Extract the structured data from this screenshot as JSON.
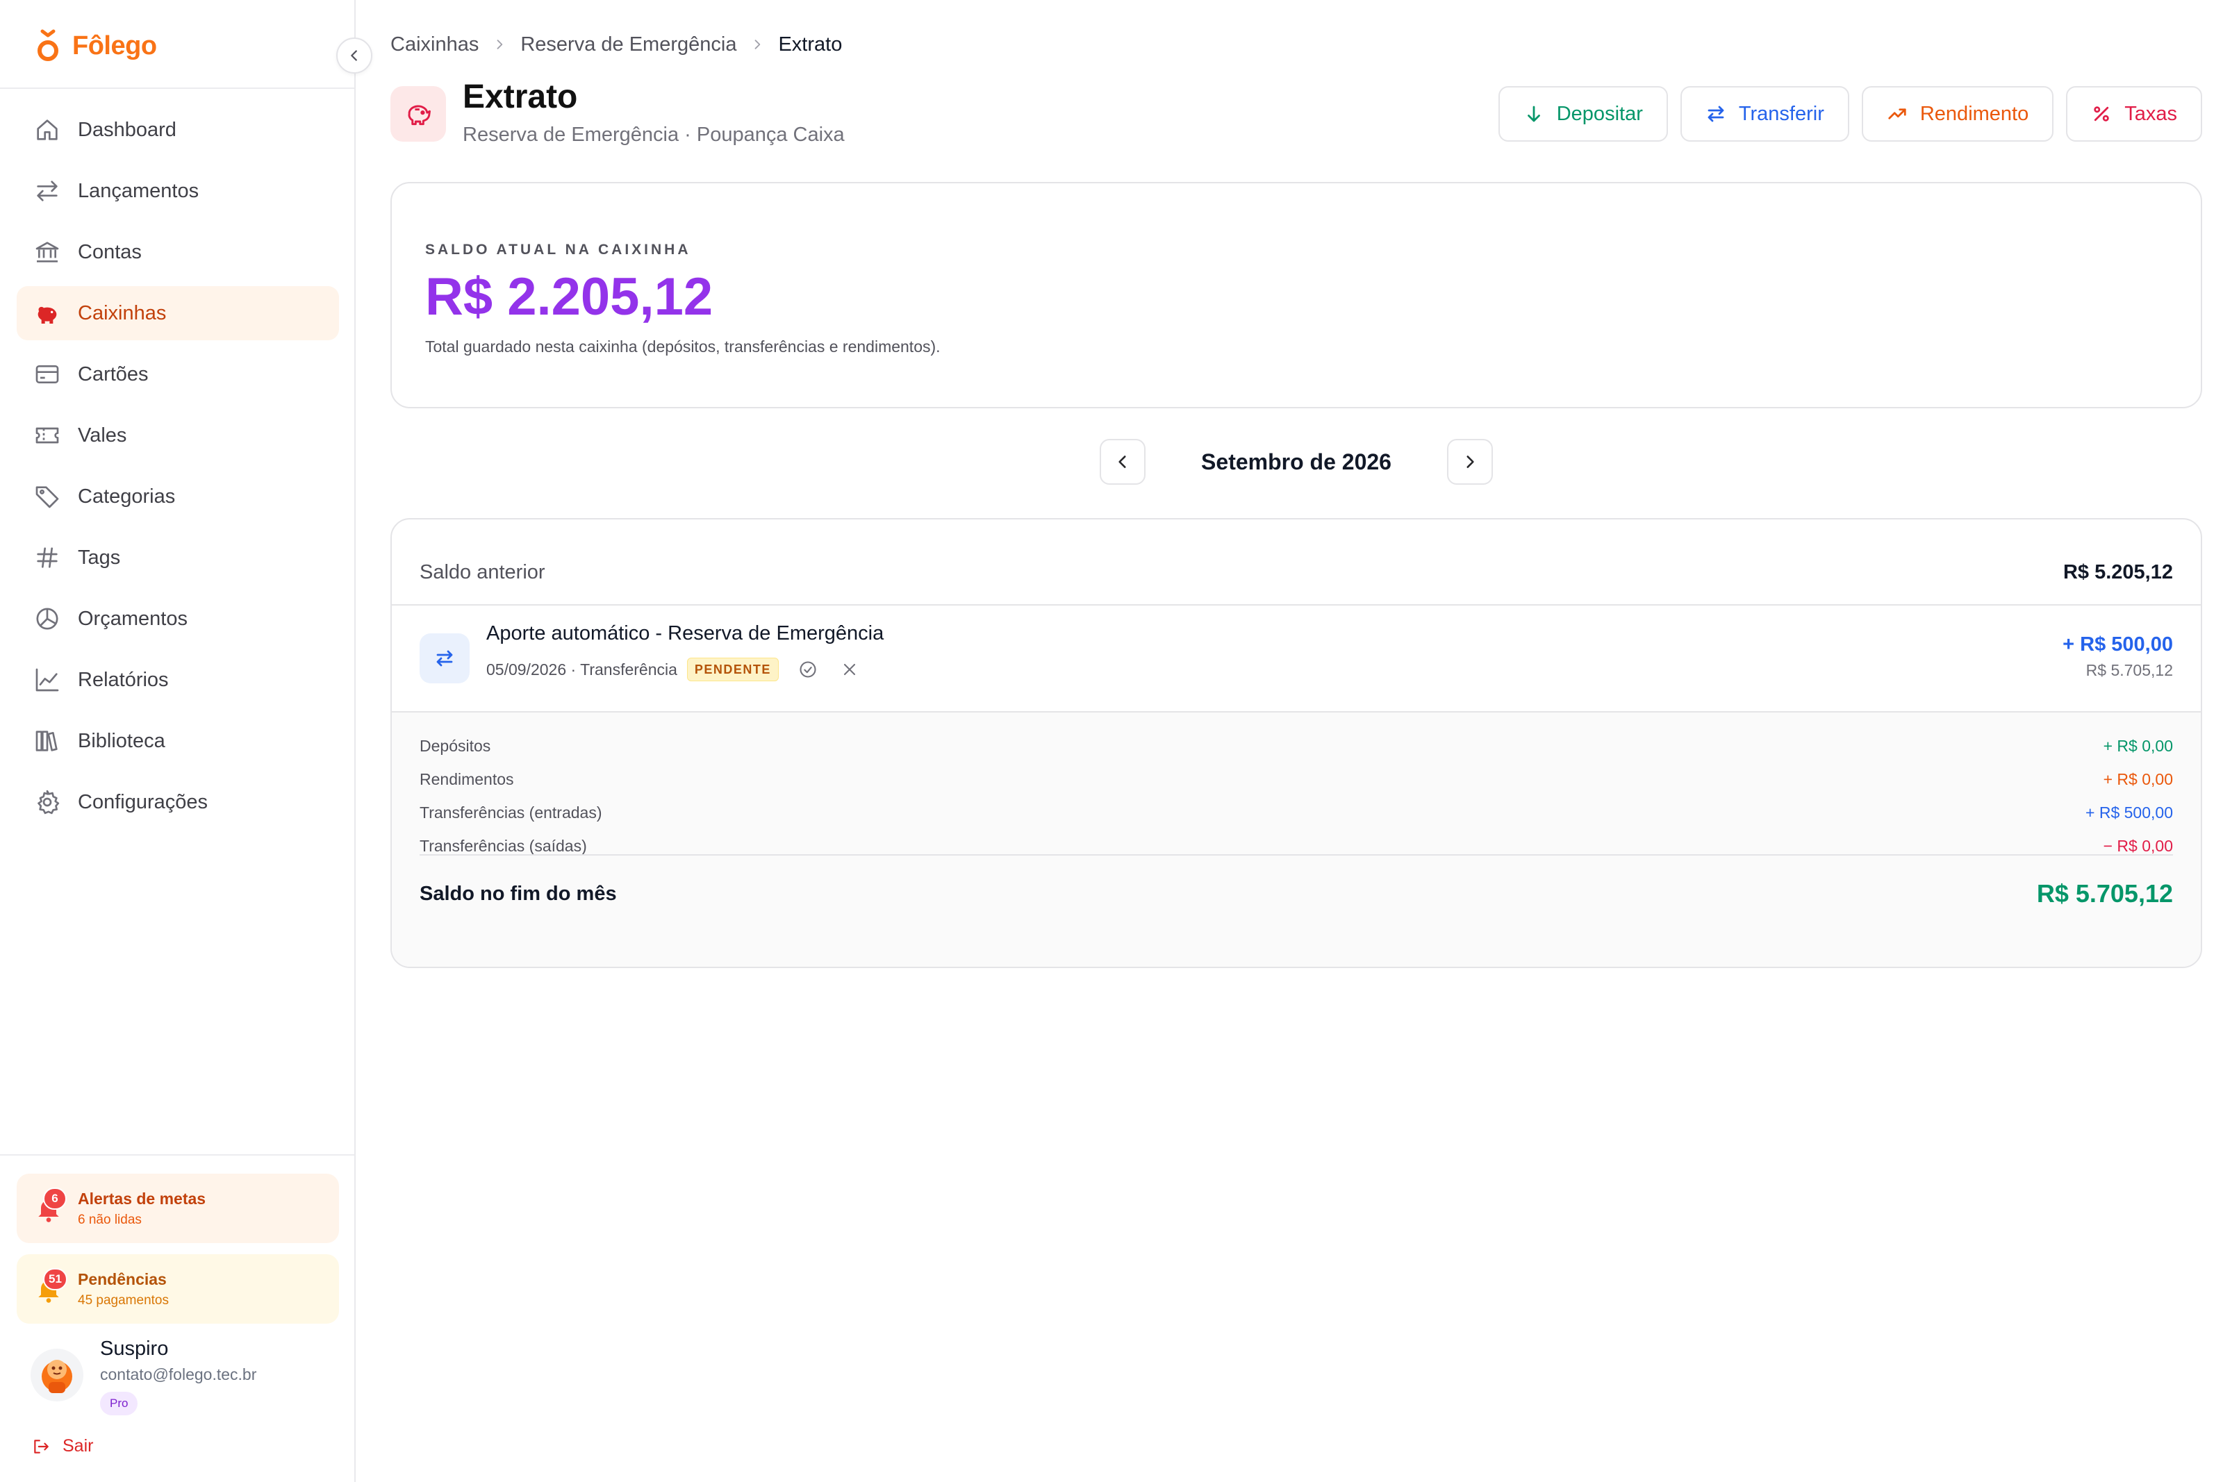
{
  "brand": {
    "name": "Fôlego",
    "color": "#f97316"
  },
  "sidebar": {
    "items": [
      {
        "label": "Dashboard",
        "icon": "home-icon"
      },
      {
        "label": "Lançamentos",
        "icon": "swap-icon"
      },
      {
        "label": "Contas",
        "icon": "bank-icon"
      },
      {
        "label": "Caixinhas",
        "icon": "piggy-bank-icon",
        "active": true
      },
      {
        "label": "Cartões",
        "icon": "credit-card-icon"
      },
      {
        "label": "Vales",
        "icon": "ticket-icon"
      },
      {
        "label": "Categorias",
        "icon": "tag-icon"
      },
      {
        "label": "Tags",
        "icon": "hash-icon"
      },
      {
        "label": "Orçamentos",
        "icon": "pie-chart-icon"
      },
      {
        "label": "Relatórios",
        "icon": "line-chart-icon"
      },
      {
        "label": "Biblioteca",
        "icon": "library-icon"
      },
      {
        "label": "Configurações",
        "icon": "gear-icon"
      }
    ],
    "alerts": {
      "metas": {
        "count": "6",
        "title": "Alertas de metas",
        "subtitle": "6 não lidas"
      },
      "pendencias": {
        "count": "51",
        "title": "Pendências",
        "subtitle": "45 pagamentos"
      }
    },
    "user": {
      "name": "Suspiro",
      "email": "contato@folego.tec.br",
      "plan": "Pro"
    },
    "logout_label": "Sair"
  },
  "breadcrumb": [
    "Caixinhas",
    "Reserva de Emergência",
    "Extrato"
  ],
  "header": {
    "title": "Extrato",
    "subtitle": "Reserva de Emergência · Poupança Caixa"
  },
  "actions": {
    "deposit": "Depositar",
    "transfer": "Transferir",
    "yield": "Rendimento",
    "fees": "Taxas"
  },
  "balance": {
    "label": "SALDO ATUAL NA CAIXINHA",
    "value": "R$ 2.205,12",
    "note": "Total guardado nesta caixinha (depósitos, transferências e rendimentos)."
  },
  "month": {
    "label": "Setembro de 2026"
  },
  "statement": {
    "previous_label": "Saldo anterior",
    "previous_value": "R$ 5.205,12",
    "transactions": [
      {
        "title": "Aporte automático - Reserva de Emergência",
        "meta": "05/09/2026 · Transferência",
        "status": "PENDENTE",
        "amount": "+ R$ 500,00",
        "running_balance": "R$ 5.705,12"
      }
    ],
    "summary": {
      "deposits_label": "Depósitos",
      "deposits_value": "+ R$ 0,00",
      "yield_label": "Rendimentos",
      "yield_value": "+ R$ 0,00",
      "transfers_in_label": "Transferências (entradas)",
      "transfers_in_value": "+ R$ 500,00",
      "transfers_out_label": "Transferências (saídas)",
      "transfers_out_value": "− R$ 0,00",
      "end_label": "Saldo no fim do mês",
      "end_value": "R$ 5.705,12"
    }
  },
  "colors": {
    "accent": "#f97316",
    "balance": "#9333ea",
    "deposit": "#059669",
    "transfer": "#2563eb",
    "yield": "#ea580c",
    "fees": "#e11d48"
  }
}
